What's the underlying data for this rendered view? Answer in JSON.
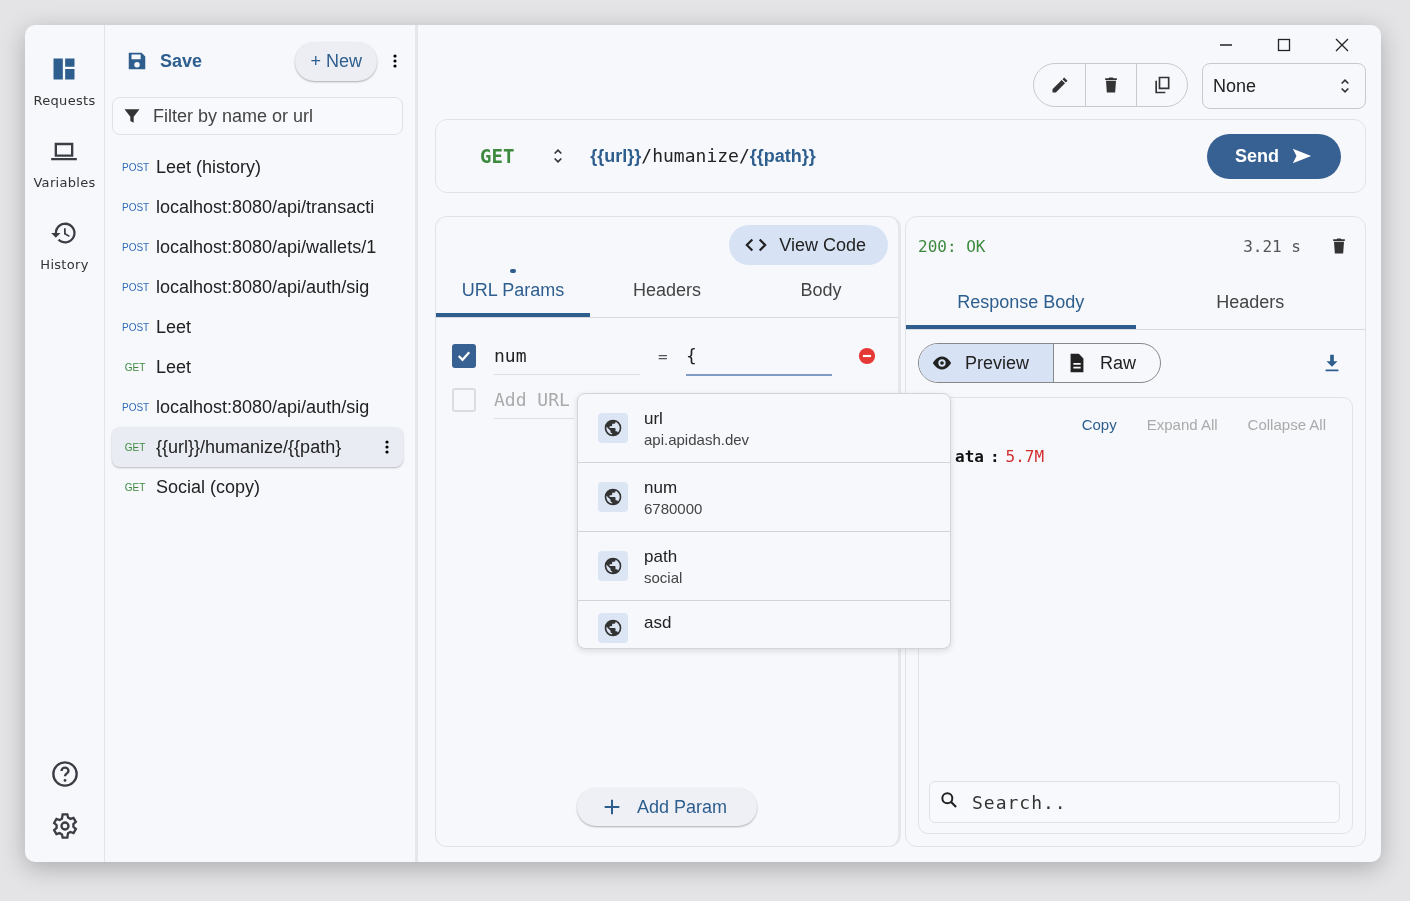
{
  "rail": {
    "items": [
      {
        "label": "Requests",
        "kind": "requests",
        "selected": true
      },
      {
        "label": "Variables",
        "kind": "variables",
        "selected": false
      },
      {
        "label": "History",
        "kind": "history",
        "selected": false
      }
    ]
  },
  "sidebar": {
    "save": "Save",
    "new": "+ New",
    "filter": {
      "placeholder": "Filter by name or url"
    },
    "items": [
      {
        "method": "POST",
        "color": "#2f6db5",
        "name": "Leet (history)",
        "selected": false
      },
      {
        "method": "POST",
        "color": "#2f6db5",
        "name": "localhost:8080/api/transacti",
        "selected": false
      },
      {
        "method": "POST",
        "color": "#2f6db5",
        "name": "localhost:8080/api/wallets/1",
        "selected": false
      },
      {
        "method": "POST",
        "color": "#2f6db5",
        "name": "localhost:8080/api/auth/sig",
        "selected": false
      },
      {
        "method": "POST",
        "color": "#2f6db5",
        "name": "Leet",
        "selected": false
      },
      {
        "method": "GET",
        "color": "#3d8a3f",
        "name": "Leet",
        "selected": false
      },
      {
        "method": "POST",
        "color": "#2f6db5",
        "name": "localhost:8080/api/auth/sig",
        "selected": false
      },
      {
        "method": "GET",
        "color": "#3d8a3f",
        "name": "{{url}}/humanize/{{path}",
        "selected": true
      },
      {
        "method": "GET",
        "color": "#3d8a3f",
        "name": "Social (copy)",
        "selected": false
      }
    ]
  },
  "environment": {
    "value": "None"
  },
  "request": {
    "method": "GET",
    "url": [
      {
        "kind": "variable",
        "text": "{{url}}"
      },
      {
        "kind": "text",
        "text": "/humanize/"
      },
      {
        "kind": "variable",
        "text": "{{path}}"
      }
    ],
    "send": "Send",
    "view_code": "View Code",
    "tabs": [
      {
        "label": "URL Params",
        "selected": true,
        "has_content": true
      },
      {
        "label": "Headers",
        "selected": false,
        "has_content": false
      },
      {
        "label": "Body",
        "selected": false,
        "has_content": false
      }
    ],
    "params": [
      {
        "checked": true,
        "key": "num",
        "separator": "=",
        "value": "{"
      },
      {
        "checked": false,
        "placeholder": "Add URL"
      }
    ],
    "add_param": "Add Param",
    "suggestions": [
      {
        "name": "url",
        "value": "api.apidash.dev"
      },
      {
        "name": "num",
        "value": "6780000"
      },
      {
        "name": "path",
        "value": "social"
      },
      {
        "name": "asd"
      }
    ]
  },
  "response": {
    "status": "200: OK",
    "time": "3.21 s",
    "tabs": [
      {
        "label": "Response Body",
        "selected": true
      },
      {
        "label": "Headers",
        "selected": false
      }
    ],
    "views": [
      {
        "label": "Preview",
        "kind": "preview",
        "selected": true
      },
      {
        "label": "Raw",
        "kind": "raw",
        "selected": false
      }
    ],
    "actions": [
      {
        "label": "Copy",
        "disabled": false
      },
      {
        "label": "Expand All",
        "disabled": true
      },
      {
        "label": "Collapse All",
        "disabled": true
      }
    ],
    "body": [
      {
        "key": "ata",
        "colon": ":",
        "value": "5.7M"
      }
    ],
    "search": {
      "placeholder": "Search.."
    }
  }
}
